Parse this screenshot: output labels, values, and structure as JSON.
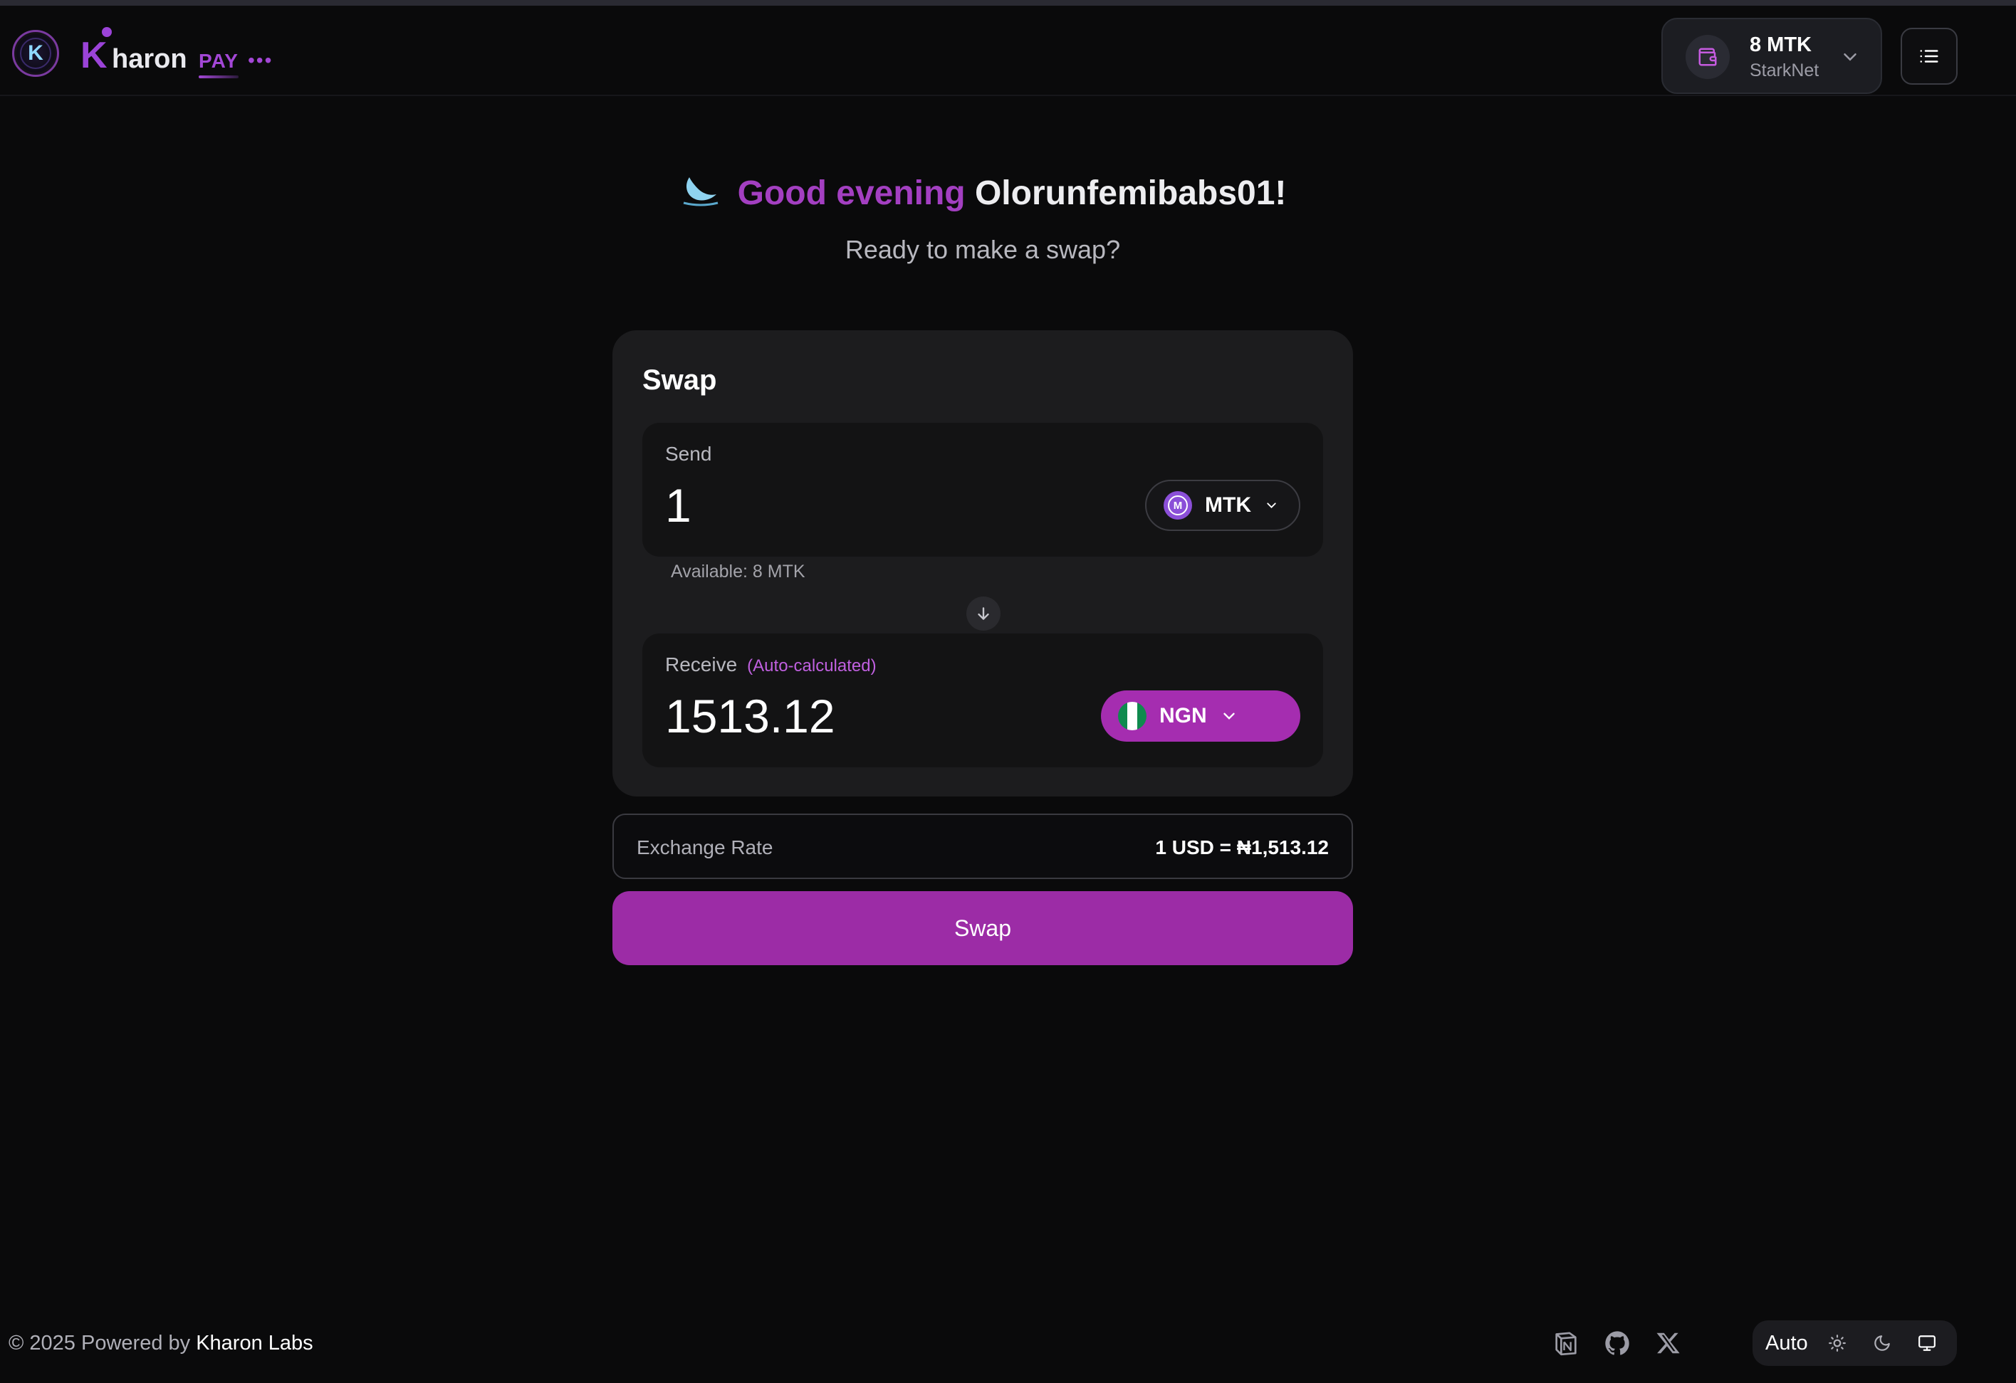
{
  "header": {
    "logo_letter": "K",
    "brand_k": "K",
    "brand_name": "haron",
    "brand_pay": "PAY",
    "brand_dots": "•••",
    "wallet": {
      "amount": "8 MTK",
      "network": "StarkNet"
    }
  },
  "greeting": {
    "salutation": "Good evening",
    "name": "Olorunfemibabs01!",
    "subtitle": "Ready to make a swap?"
  },
  "swap": {
    "title": "Swap",
    "send": {
      "label": "Send",
      "amount": "1",
      "token": "MTK",
      "token_icon_letter": "M",
      "available": "Available: 8 MTK"
    },
    "receive": {
      "label": "Receive",
      "note": "(Auto-calculated)",
      "amount": "1513.12",
      "currency": "NGN"
    }
  },
  "exchange_rate": {
    "label": "Exchange Rate",
    "value": "1 USD = ₦1,513.12"
  },
  "swap_button": "Swap",
  "footer": {
    "copyright": "© 2025 Powered by",
    "company": "Kharon Labs",
    "social_icons": [
      "notion-icon",
      "github-icon",
      "x-icon"
    ],
    "theme": {
      "label": "Auto",
      "options": [
        "sun-icon",
        "moon-icon",
        "monitor-icon"
      ]
    }
  },
  "colors": {
    "background": "#0a0a0b",
    "accent": "#a52db0",
    "brand_purple": "#9b43d8",
    "card": "#1c1c1e"
  }
}
